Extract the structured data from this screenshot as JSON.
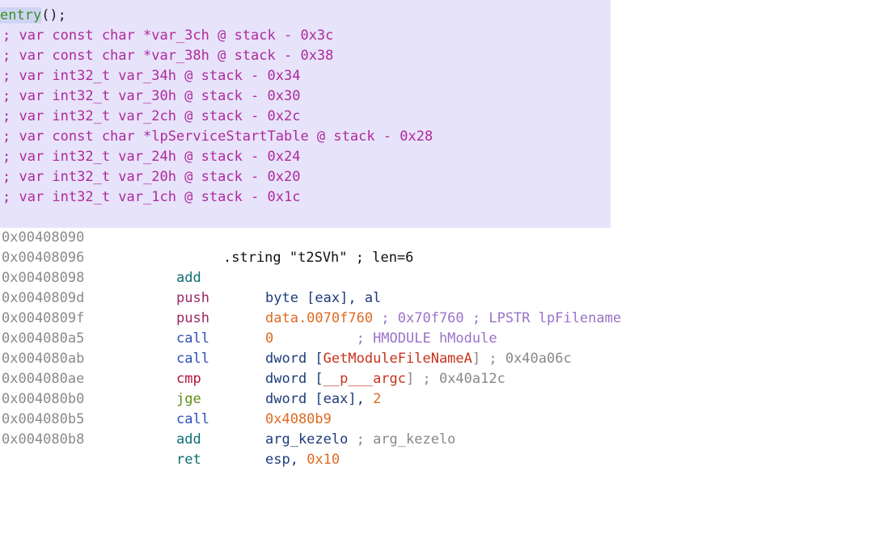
{
  "entry": {
    "name": "entry",
    "parens": "();"
  },
  "vars": [
    "; var const char *var_3ch @ stack - 0x3c",
    "; var const char *var_38h @ stack - 0x38",
    "; var int32_t var_34h @ stack - 0x34",
    "; var int32_t var_30h @ stack - 0x30",
    "; var int32_t var_2ch @ stack - 0x2c",
    "; var const char *lpServiceStartTable @ stack - 0x28",
    "; var int32_t var_24h @ stack - 0x24",
    "; var int32_t var_20h @ stack - 0x20",
    "; var int32_t var_1ch @ stack - 0x1c"
  ],
  "string_line": {
    "address": "0x00408090",
    "text": ".string \"t2SVh\" ; len=6"
  },
  "instructions": [
    {
      "address": "0x00408096",
      "mnemonic": "add",
      "op1": "byte [eax], al",
      "op2": "",
      "op3": ""
    },
    {
      "address": "0x00408098",
      "mnemonic": "push",
      "op1": "data.0070f760",
      "op2": " ; 0x70f760 ; LPSTR lpFilename",
      "op3": ""
    },
    {
      "address": "0x0040809d",
      "mnemonic": "push",
      "op1": "0",
      "op2": "          ; HMODULE hModule",
      "op3": ""
    },
    {
      "address": "0x0040809f",
      "mnemonic": "call",
      "op1": "dword [",
      "op2": "GetModuleFileNameA",
      "op3": "] ; 0x40a06c"
    },
    {
      "address": "0x004080a5",
      "mnemonic": "call",
      "op1": "dword [",
      "op2": "__p___argc",
      "op3": "] ; 0x40a12c"
    },
    {
      "address": "0x004080ab",
      "mnemonic": "cmp",
      "op1": "dword [eax], ",
      "op2": "2",
      "op3": ""
    },
    {
      "address": "0x004080ae",
      "mnemonic": "jge",
      "op1": "0x4080b9",
      "op2": "",
      "op3": ""
    },
    {
      "address": "0x004080b0",
      "mnemonic": "call",
      "op1": "arg_kezelo",
      "op2": " ; arg_kezelo",
      "op3": ""
    },
    {
      "address": "0x004080b5",
      "mnemonic": "add",
      "op1": "esp, ",
      "op2": "0x10",
      "op3": ""
    },
    {
      "address": "0x004080b8",
      "mnemonic": "ret",
      "op1": "",
      "op2": "",
      "op3": ""
    }
  ],
  "colors": {
    "highlight_background": "#e6e3fb",
    "comment": "#b02a9a",
    "address": "#8a8a8a",
    "number": "#de6a22"
  }
}
